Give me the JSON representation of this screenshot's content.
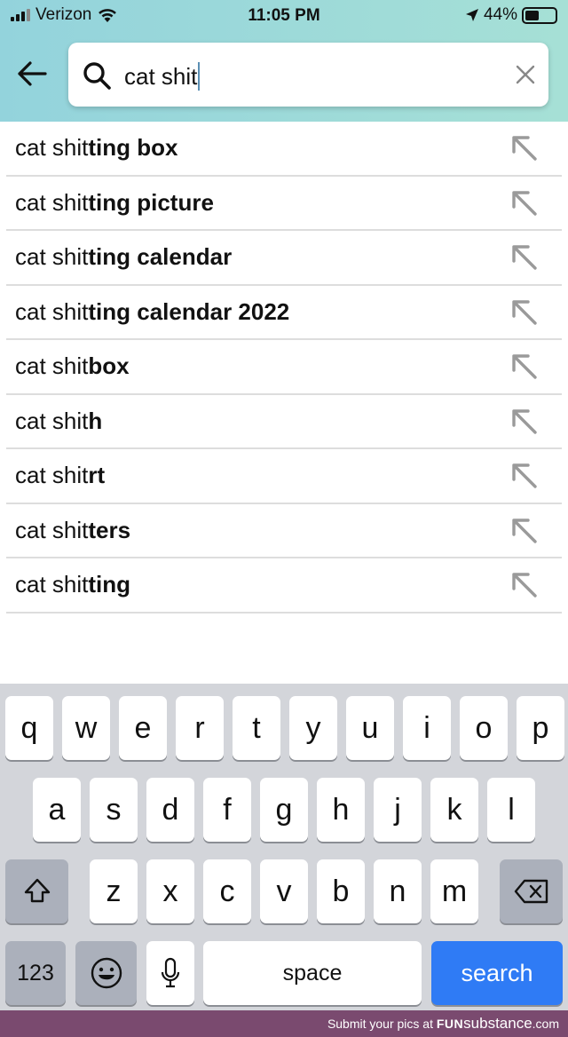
{
  "status_bar": {
    "carrier": "Verizon",
    "time": "11:05 PM",
    "battery": "44%",
    "battery_level": 0.44
  },
  "search": {
    "query": "cat shit"
  },
  "suggestions": [
    {
      "typed": "cat shit",
      "completion": "ting box"
    },
    {
      "typed": "cat shit",
      "completion": "ting picture"
    },
    {
      "typed": "cat shit",
      "completion": "ting calendar"
    },
    {
      "typed": "cat shit",
      "completion": "ting calendar 2022"
    },
    {
      "typed": "cat shit",
      "completion": "box"
    },
    {
      "typed": "cat shit",
      "completion": "h"
    },
    {
      "typed": "cat shit",
      "completion": "rt"
    },
    {
      "typed": "cat shit",
      "completion": "ters"
    },
    {
      "typed": "cat shit",
      "completion": "ting"
    }
  ],
  "keyboard": {
    "row1": [
      "q",
      "w",
      "e",
      "r",
      "t",
      "y",
      "u",
      "i",
      "o",
      "p"
    ],
    "row2": [
      "a",
      "s",
      "d",
      "f",
      "g",
      "h",
      "j",
      "k",
      "l"
    ],
    "row3": [
      "z",
      "x",
      "c",
      "v",
      "b",
      "n",
      "m"
    ],
    "numbers_label": "123",
    "space_label": "space",
    "search_label": "search"
  },
  "footer": {
    "prefix": "Submit your pics at ",
    "brand_bold": "FUN",
    "brand": "substance",
    "suffix": ".com"
  },
  "colors": {
    "header": "#9fdad8",
    "search_key": "#2f7bf5",
    "footer": "#7a4a6f"
  }
}
